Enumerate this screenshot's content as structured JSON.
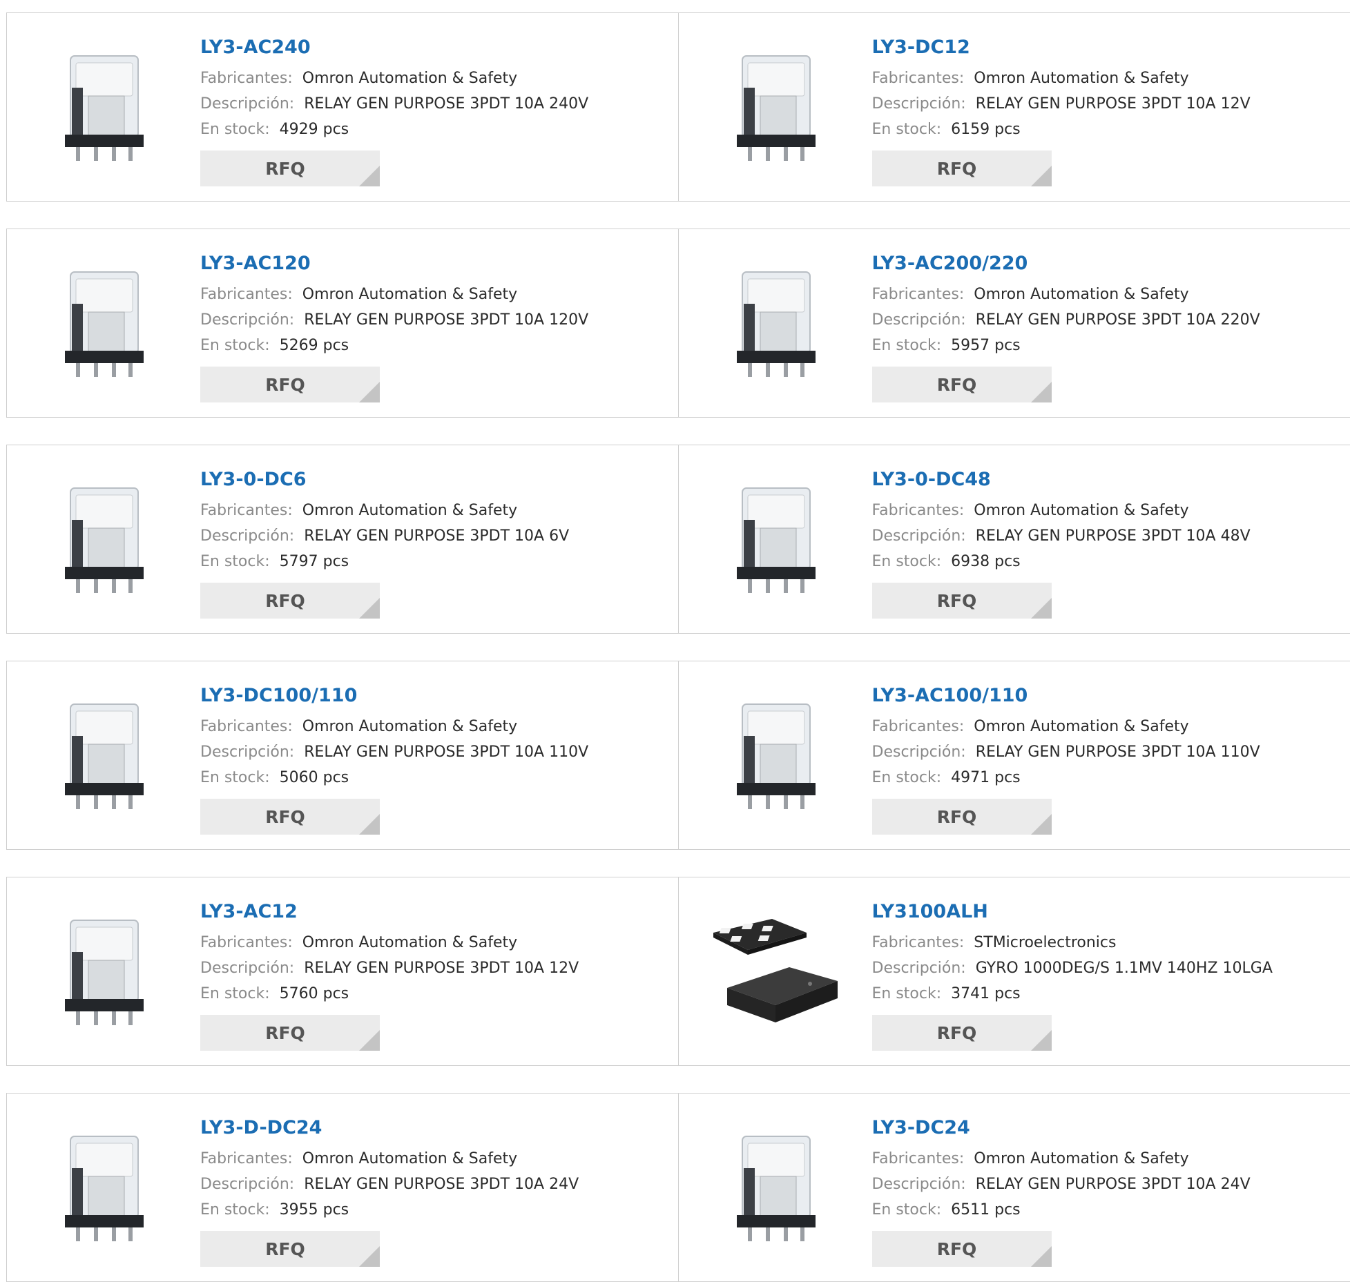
{
  "labels": {
    "manufacturer": "Fabricantes:",
    "description": "Descripción:",
    "stock": "En stock:",
    "rfq": "RFQ"
  },
  "products": [
    {
      "part": "LY3-AC240",
      "manufacturer": "Omron Automation & Safety",
      "description": "RELAY GEN PURPOSE 3PDT 10A 240V",
      "stock": "4929 pcs",
      "image": "relay-icon"
    },
    {
      "part": "LY3-DC12",
      "manufacturer": "Omron Automation & Safety",
      "description": "RELAY GEN PURPOSE 3PDT 10A 12V",
      "stock": "6159 pcs",
      "image": "relay-icon"
    },
    {
      "part": "LY3-AC120",
      "manufacturer": "Omron Automation & Safety",
      "description": "RELAY GEN PURPOSE 3PDT 10A 120V",
      "stock": "5269 pcs",
      "image": "relay-icon"
    },
    {
      "part": "LY3-AC200/220",
      "manufacturer": "Omron Automation & Safety",
      "description": "RELAY GEN PURPOSE 3PDT 10A 220V",
      "stock": "5957 pcs",
      "image": "relay-icon"
    },
    {
      "part": "LY3-0-DC6",
      "manufacturer": "Omron Automation & Safety",
      "description": "RELAY GEN PURPOSE 3PDT 10A 6V",
      "stock": "5797 pcs",
      "image": "relay-icon"
    },
    {
      "part": "LY3-0-DC48",
      "manufacturer": "Omron Automation & Safety",
      "description": "RELAY GEN PURPOSE 3PDT 10A 48V",
      "stock": "6938 pcs",
      "image": "relay-icon"
    },
    {
      "part": "LY3-DC100/110",
      "manufacturer": "Omron Automation & Safety",
      "description": "RELAY GEN PURPOSE 3PDT 10A 110V",
      "stock": "5060 pcs",
      "image": "relay-icon"
    },
    {
      "part": "LY3-AC100/110",
      "manufacturer": "Omron Automation & Safety",
      "description": "RELAY GEN PURPOSE 3PDT 10A 110V",
      "stock": "4971 pcs",
      "image": "relay-icon"
    },
    {
      "part": "LY3-AC12",
      "manufacturer": "Omron Automation & Safety",
      "description": "RELAY GEN PURPOSE 3PDT 10A 12V",
      "stock": "5760 pcs",
      "image": "relay-icon"
    },
    {
      "part": "LY3100ALH",
      "manufacturer": "STMicroelectronics",
      "description": "GYRO 1000DEG/S 1.1MV 140HZ 10LGA",
      "stock": "3741 pcs",
      "image": "lga-chip-icon"
    },
    {
      "part": "LY3-D-DC24",
      "manufacturer": "Omron Automation & Safety",
      "description": "RELAY GEN PURPOSE 3PDT 10A 24V",
      "stock": "3955 pcs",
      "image": "relay-icon"
    },
    {
      "part": "LY3-DC24",
      "manufacturer": "Omron Automation & Safety",
      "description": "RELAY GEN PURPOSE 3PDT 10A 24V",
      "stock": "6511 pcs",
      "image": "relay-icon"
    }
  ]
}
